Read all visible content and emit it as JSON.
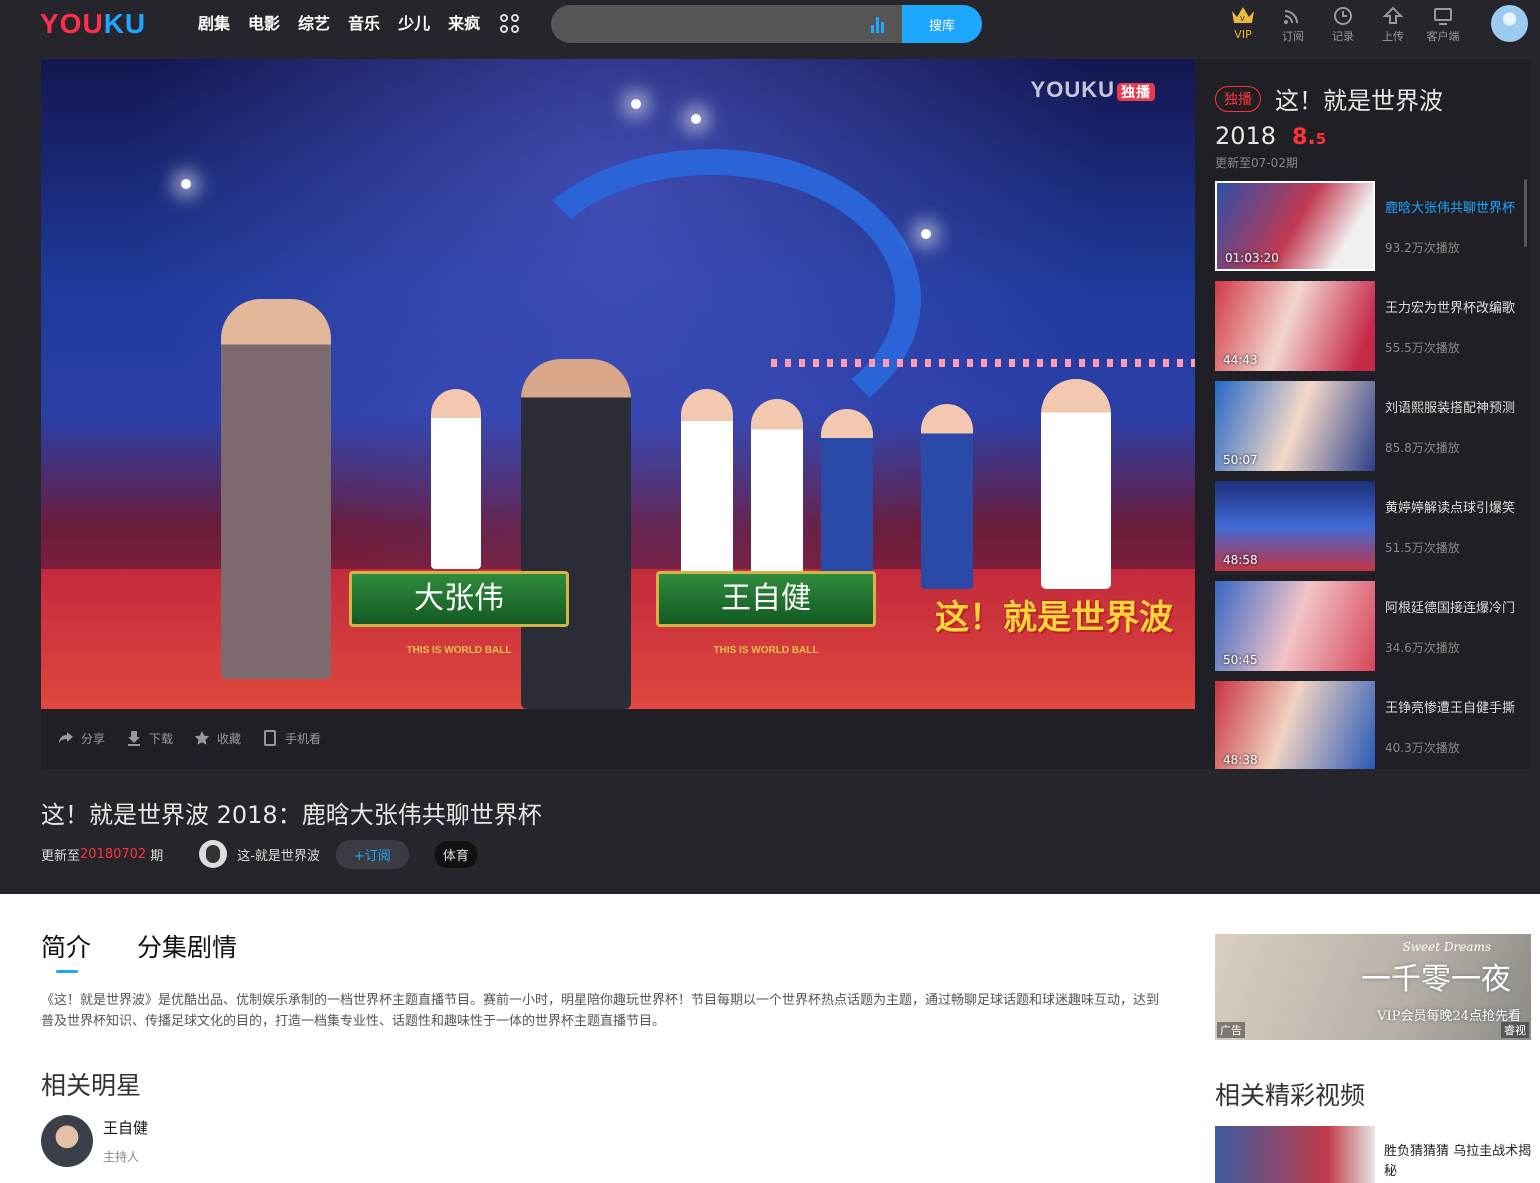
{
  "header": {
    "logo": {
      "part1": "YOU",
      "part2": "KU"
    },
    "nav": [
      "剧集",
      "电影",
      "综艺",
      "音乐",
      "少儿",
      "来疯"
    ],
    "search": {
      "placeholder": "",
      "button": "搜库"
    },
    "tools": [
      {
        "label": "VIP",
        "icon": "crown-icon"
      },
      {
        "label": "订阅",
        "icon": "rss-icon"
      },
      {
        "label": "记录",
        "icon": "clock-icon"
      },
      {
        "label": "上传",
        "icon": "upload-icon"
      },
      {
        "label": "客户端",
        "icon": "monitor-icon"
      }
    ]
  },
  "player": {
    "watermark": "YOUKU",
    "watermark_badge": "独播",
    "name_cards": [
      {
        "name": "大张伟",
        "sub": "THIS IS WORLD BALL"
      },
      {
        "name": "王自健",
        "sub": "THIS IS WORLD BALL"
      }
    ],
    "show_logo": "这！就是世界波",
    "actions": [
      {
        "label": "分享",
        "icon": "share-icon"
      },
      {
        "label": "下载",
        "icon": "download-icon"
      },
      {
        "label": "收藏",
        "icon": "star-icon"
      },
      {
        "label": "手机看",
        "icon": "phone-icon"
      }
    ]
  },
  "sidebar": {
    "badge": "独播",
    "title": "这！就是世界波",
    "year": "2018",
    "score_int": "8.",
    "score_dec": "5",
    "update": "更新至07-02期",
    "items": [
      {
        "title": "鹿晗大张伟共聊世界杯",
        "plays": "93.2万次播放",
        "duration": "01:03:20",
        "active": true
      },
      {
        "title": "王力宏为世界杯改编歌",
        "plays": "55.5万次播放",
        "duration": "44:43"
      },
      {
        "title": "刘语熙服装搭配神预测",
        "plays": "85.8万次播放",
        "duration": "50:07"
      },
      {
        "title": "黄婷婷解读点球引爆笑",
        "plays": "51.5万次播放",
        "duration": "48:58"
      },
      {
        "title": "阿根廷德国接连爆冷门",
        "plays": "34.6万次播放",
        "duration": "50:45"
      },
      {
        "title": "王铮亮惨遭王自健手撕",
        "plays": "40.3万次播放",
        "duration": "48:38"
      }
    ]
  },
  "episode": {
    "title": "这！就是世界波 2018：鹿晗大张伟共聊世界杯",
    "update_prefix": "更新至",
    "update_num": "20180702",
    "update_suffix": "期",
    "channel": "这-就是世界波",
    "subscribe": "+订阅",
    "tag": "体育"
  },
  "content": {
    "tabs": [
      "简介",
      "分集剧情"
    ],
    "description": "《这！就是世界波》是优酷出品、优制娱乐承制的一档世界杯主题直播节目。赛前一小时，明星陪你趣玩世界杯！节目每期以一个世界杯热点话题为主题，通过畅聊足球话题和球迷趣味互动，达到普及世界杯知识、传播足球文化的目的，打造一档集专业性、话题性和趣味性于一体的世界杯主题直播节目。",
    "stars_heading": "相关明星",
    "stars": [
      {
        "name": "王自健",
        "role": "主持人"
      }
    ]
  },
  "right": {
    "ad": {
      "title": "一千零一夜",
      "subtitle": "Sweet Dreams",
      "line": "VIP会员每晚24点抢先看",
      "tag": "广告",
      "brand": "睿视"
    },
    "related_heading": "相关精彩视频",
    "related": [
      {
        "title": "胜负猜猜猜 乌拉圭战术揭秘"
      }
    ]
  },
  "colors": {
    "brand_blue": "#1ea7ff",
    "brand_red": "#ff2e4d",
    "accent_red": "#ff3333",
    "dark_bg": "#25252b"
  }
}
